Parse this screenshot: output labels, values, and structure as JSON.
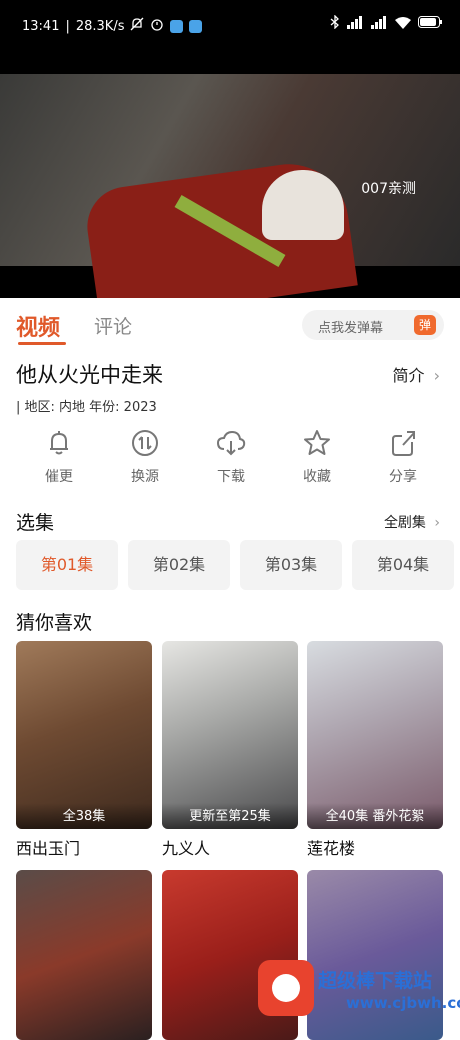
{
  "status_bar": {
    "time": "13:41",
    "speed": "28.3K/s"
  },
  "video": {
    "watermark": "007亲测"
  },
  "tabs": {
    "video": "视频",
    "comment": "评论"
  },
  "danmaku": {
    "placeholder": "点我发弹幕",
    "icon_text": "弹"
  },
  "show": {
    "title": "他从火光中走来",
    "intro": "简介",
    "meta": "|  地区: 内地    年份: 2023"
  },
  "actions": [
    {
      "label": "催更",
      "icon": "bell-icon"
    },
    {
      "label": "换源",
      "icon": "switch-source-icon"
    },
    {
      "label": "下载",
      "icon": "cloud-download-icon"
    },
    {
      "label": "收藏",
      "icon": "star-icon"
    },
    {
      "label": "分享",
      "icon": "share-icon"
    }
  ],
  "episodes": {
    "section_title": "选集",
    "all_label": "全剧集",
    "items": [
      "第01集",
      "第02集",
      "第03集",
      "第04集"
    ],
    "selected": "第01集",
    "accent": "#e0592a"
  },
  "recommend": {
    "section_title": "猜你喜欢",
    "items": [
      {
        "title": "西出玉门",
        "caption": "全38集"
      },
      {
        "title": "九义人",
        "caption": "更新至第25集"
      },
      {
        "title": "莲花楼",
        "caption": "全40集 番外花絮"
      }
    ]
  },
  "site": {
    "name": "超级棒下载站",
    "url": "www.cjbwh.com"
  }
}
